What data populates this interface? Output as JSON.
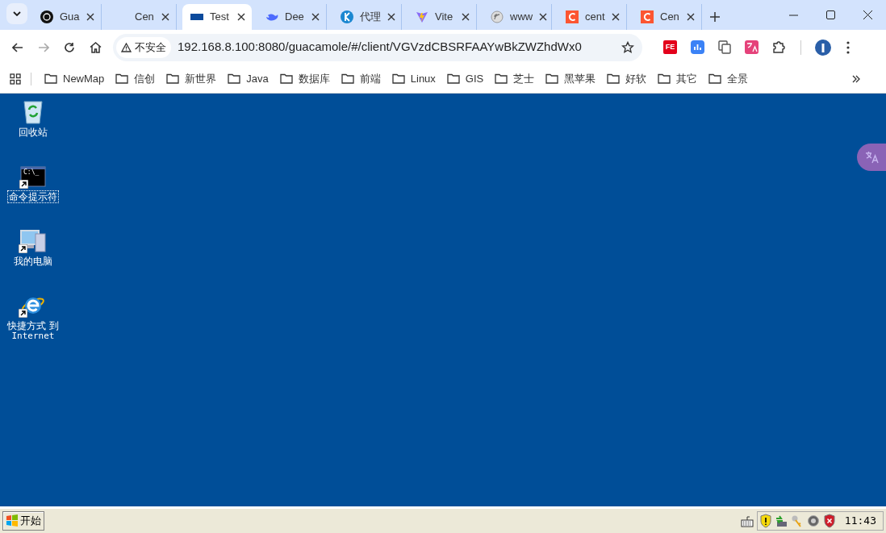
{
  "tabs": [
    {
      "title": "Gua",
      "kind": "openai",
      "selected": false
    },
    {
      "title": "Cen",
      "kind": "blank",
      "selected": false
    },
    {
      "title": "Test",
      "kind": "flag",
      "selected": true
    },
    {
      "title": "Dee",
      "kind": "whale",
      "selected": false
    },
    {
      "title": "代理",
      "kind": "k",
      "selected": false
    },
    {
      "title": "Vite",
      "kind": "vite",
      "selected": false
    },
    {
      "title": "www",
      "kind": "feed",
      "selected": false
    },
    {
      "title": "cent",
      "kind": "c",
      "selected": false
    },
    {
      "title": "Cen",
      "kind": "c",
      "selected": false
    }
  ],
  "address": {
    "security": "不安全",
    "url": "192.168.8.100:8080/guacamole/#/client/VGVzdCBSRFAAYwBkZWZhdWx0"
  },
  "extensions": [
    {
      "kind": "fe",
      "label": "FE"
    },
    {
      "kind": "chart"
    },
    {
      "kind": "copy"
    },
    {
      "kind": "translate"
    },
    {
      "kind": "puzzle"
    }
  ],
  "bookmarks": [
    "NewMap",
    "信创",
    "新世界",
    "Java",
    "数据库",
    "前端",
    "Linux",
    "GIS",
    "芝士",
    "黑苹果",
    "好软",
    "其它",
    "全景"
  ],
  "desktop_icons": [
    {
      "kind": "recycle",
      "lines": [
        "回收站"
      ],
      "shortcut": false,
      "selected": false
    },
    {
      "kind": "cmd",
      "glyph": "C:\\_",
      "lines": [
        "命令提示符"
      ],
      "shortcut": true,
      "selected": true
    },
    {
      "kind": "computer",
      "lines": [
        "我的电脑"
      ],
      "shortcut": true,
      "selected": false
    },
    {
      "kind": "ie",
      "lines": [
        "快捷方式 到",
        "Internet"
      ],
      "shortcut": true,
      "selected": false
    }
  ],
  "taskbar": {
    "start": "开始",
    "clock": "11:43",
    "tray": [
      {
        "kind": "keyboard"
      },
      {
        "kind": "shield-warning"
      },
      {
        "kind": "network"
      },
      {
        "kind": "keys"
      },
      {
        "kind": "speaker"
      },
      {
        "kind": "shield-error"
      }
    ]
  }
}
